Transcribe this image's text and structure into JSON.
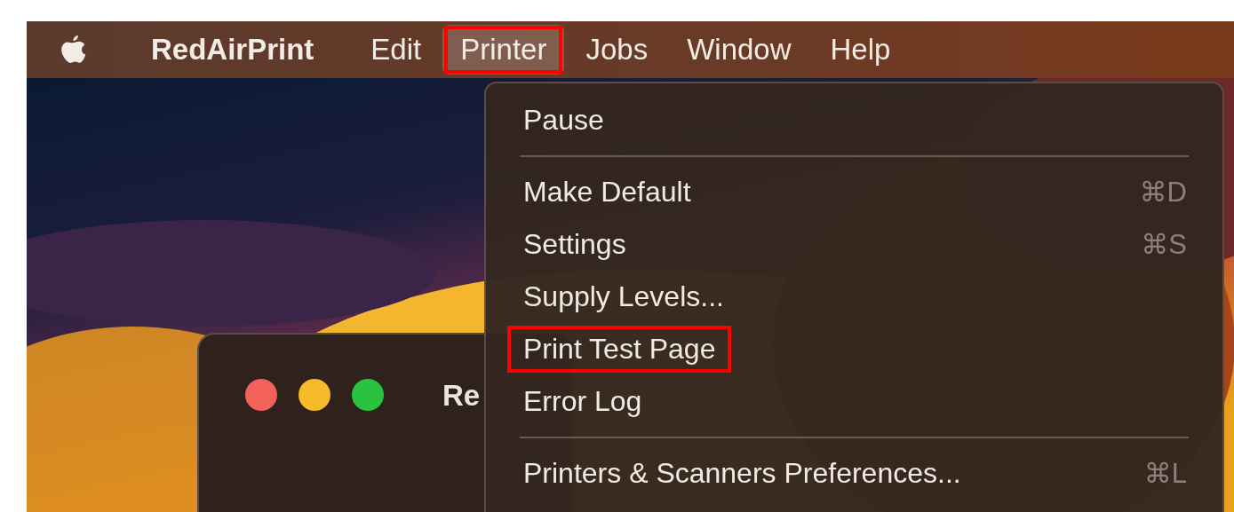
{
  "menu_bar": {
    "app_name": "RedAirPrint",
    "menus": [
      {
        "label": "Edit",
        "selected": false,
        "highlighted": false
      },
      {
        "label": "Printer",
        "selected": true,
        "highlighted": true
      },
      {
        "label": "Jobs",
        "selected": false,
        "highlighted": false
      },
      {
        "label": "Window",
        "selected": false,
        "highlighted": false
      },
      {
        "label": "Help",
        "selected": false,
        "highlighted": false
      }
    ]
  },
  "window": {
    "title": "Re"
  },
  "dropdown_menu": {
    "items": [
      {
        "kind": "item",
        "label": "Pause",
        "highlighted": false
      },
      {
        "kind": "separator"
      },
      {
        "kind": "item",
        "label": "Make Default",
        "shortcut": "⌘D",
        "highlighted": false
      },
      {
        "kind": "item",
        "label": "Settings",
        "shortcut": "⌘S",
        "highlighted": false
      },
      {
        "kind": "item",
        "label": "Supply Levels...",
        "highlighted": false
      },
      {
        "kind": "item",
        "label": "Print Test Page",
        "highlighted": true
      },
      {
        "kind": "item",
        "label": "Error Log",
        "highlighted": false
      },
      {
        "kind": "separator"
      },
      {
        "kind": "item",
        "label": "Printers & Scanners Preferences...",
        "shortcut": "⌘L",
        "highlighted": false
      }
    ]
  }
}
